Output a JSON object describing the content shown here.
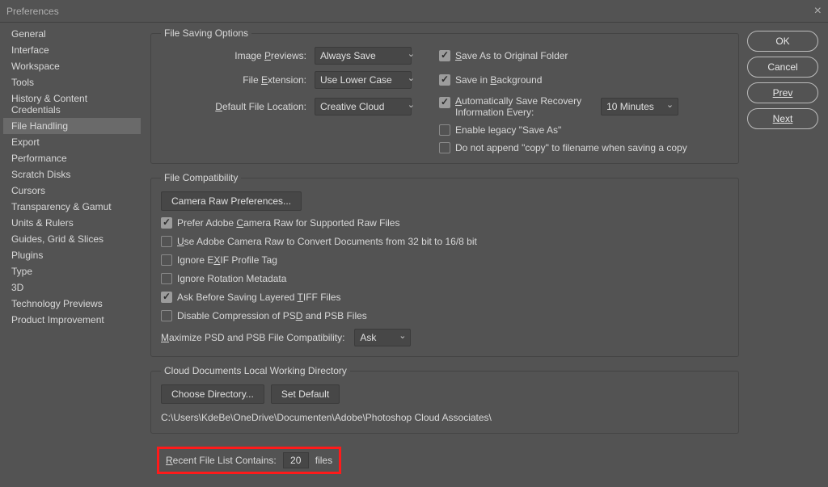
{
  "window": {
    "title": "Preferences"
  },
  "sidebar": {
    "items": [
      "General",
      "Interface",
      "Workspace",
      "Tools",
      "History & Content Credentials",
      "File Handling",
      "Export",
      "Performance",
      "Scratch Disks",
      "Cursors",
      "Transparency & Gamut",
      "Units & Rulers",
      "Guides, Grid & Slices",
      "Plugins",
      "Type",
      "3D",
      "Technology Previews",
      "Product Improvement"
    ],
    "active_index": 5
  },
  "buttons": {
    "ok": "OK",
    "cancel": "Cancel",
    "prev": "Prev",
    "next": "Next"
  },
  "fso": {
    "legend": "File Saving Options",
    "previews_label_pre": "Image ",
    "previews_label_u": "P",
    "previews_label_post": "reviews:",
    "previews_value": "Always Save",
    "ext_label_pre": "File ",
    "ext_label_u": "E",
    "ext_label_post": "xtension:",
    "ext_value": "Use Lower Case",
    "loc_label_pre": "",
    "loc_label_u": "D",
    "loc_label_post": "efault File Location:",
    "loc_value": "Creative Cloud",
    "save_as_orig_pre": "",
    "save_as_orig_u": "S",
    "save_as_orig_post": "ave As to Original Folder",
    "save_bg_pre": "Save in ",
    "save_bg_u": "B",
    "save_bg_post": "ackground",
    "auto_line1_pre": "",
    "auto_line1_u": "A",
    "auto_line1_post": "utomatically Save Recovery",
    "auto_line2": "Information Every:",
    "auto_value": "10 Minutes",
    "legacy": "Enable legacy \"Save As\"",
    "noappend": "Do not append \"copy\" to filename when saving a copy"
  },
  "fc": {
    "legend": "File Compatibility",
    "camera_raw_btn": "Camera Raw Preferences...",
    "prefer_pre": "Prefer Adobe ",
    "prefer_u": "C",
    "prefer_post": "amera Raw for Supported Raw Files",
    "useacr_pre": "",
    "useacr_u": "U",
    "useacr_post": "se Adobe Camera Raw to Convert Documents from 32 bit to 16/8 bit",
    "exif_pre": "Ignore E",
    "exif_u": "X",
    "exif_post": "IF Profile Tag",
    "rotation": "Ignore Rotation Metadata",
    "tiff_pre": "Ask Before Saving Layered ",
    "tiff_u": "T",
    "tiff_post": "IFF Files",
    "psd_pre": "Disable Compression of PS",
    "psd_u": "D",
    "psd_post": " and PSB Files",
    "max_label_pre": "",
    "max_label_u": "M",
    "max_label_post": "aximize PSD and PSB File Compatibility:",
    "max_value": "Ask"
  },
  "cloud": {
    "legend": "Cloud Documents Local Working Directory",
    "choose": "Choose Directory...",
    "setdef": "Set Default",
    "path": "C:\\Users\\KdeBe\\OneDrive\\Documenten\\Adobe\\Photoshop Cloud Associates\\"
  },
  "recent": {
    "label_pre": "",
    "label_u": "R",
    "label_post": "ecent File List Contains:",
    "value": "20",
    "suffix": "files"
  }
}
